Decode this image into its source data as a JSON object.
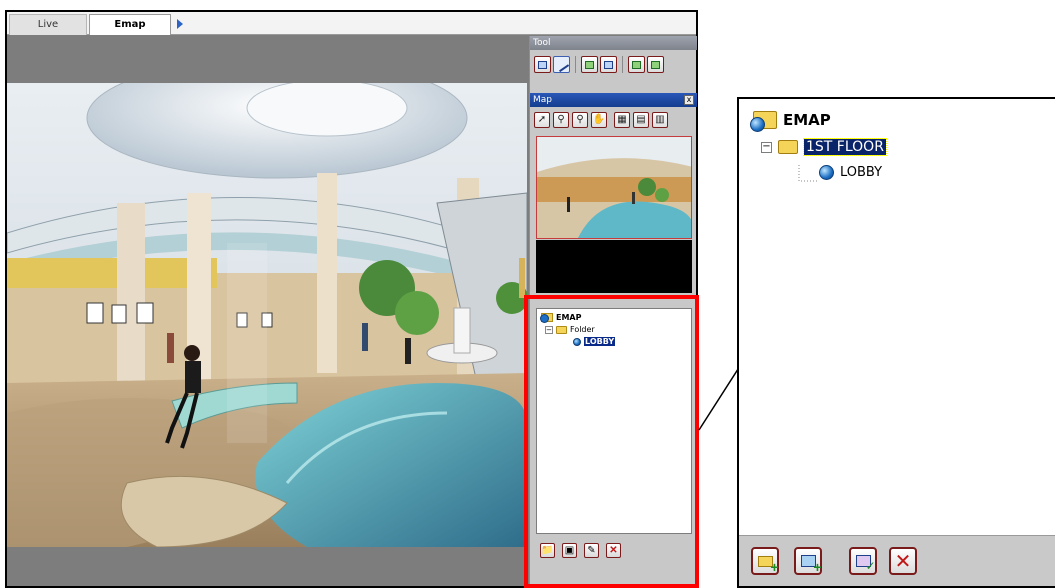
{
  "tabs": [
    {
      "label": "Live",
      "active": false
    },
    {
      "label": "Emap",
      "active": true
    }
  ],
  "panel": {
    "tool_title": "Tool",
    "map_title": "Map",
    "map_close": "x",
    "tool_buttons": [
      "device-view-icon",
      "edit-pen-icon",
      "copy-icon",
      "paste-icon",
      "import-icon",
      "save-icon"
    ],
    "map_buttons": [
      "select-arrow-icon",
      "zoom-in-icon",
      "zoom-out-icon",
      "hand-pan-icon",
      "layer-one-icon",
      "layer-two-icon",
      "layer-three-icon"
    ]
  },
  "small_tree": {
    "root": "EMAP",
    "folder": "Folder",
    "map": "LOBBY"
  },
  "zoom_tree": {
    "root": "EMAP",
    "folder": "1ST FLOOR",
    "map": "LOBBY"
  },
  "footer_buttons": [
    "add-folder-icon",
    "add-map-icon",
    "edit-map-icon",
    "delete-icon"
  ],
  "colors": {
    "highlight_red": "#ff0000",
    "selection_blue": "#0a246a",
    "map_title_blue": "#1b47a3"
  }
}
